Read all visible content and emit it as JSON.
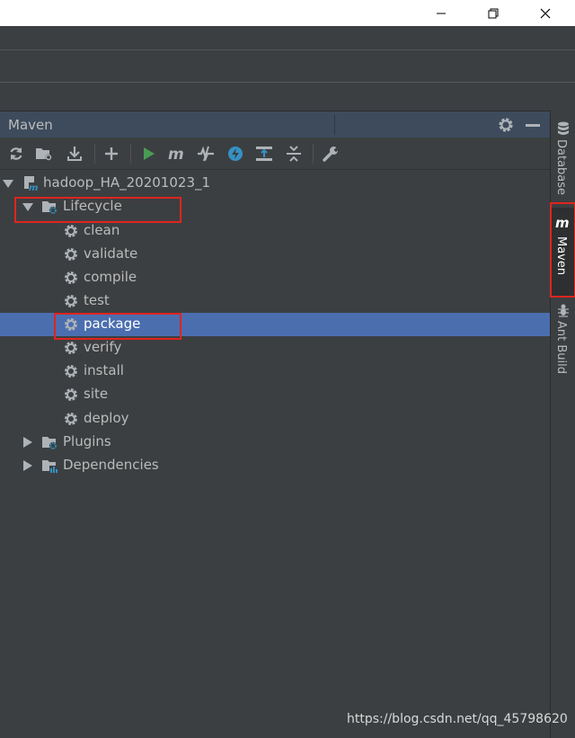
{
  "tool_window": {
    "title": "Maven"
  },
  "toolbar": {
    "buttons": [
      {
        "name": "reload-icon"
      },
      {
        "name": "generate-sources-icon"
      },
      {
        "name": "download-icon"
      },
      {
        "name": "add-icon"
      },
      {
        "name": "run-icon"
      },
      {
        "name": "maven-goal-icon"
      },
      {
        "name": "skip-tests-icon"
      },
      {
        "name": "offline-icon"
      },
      {
        "name": "show-dependencies-icon"
      },
      {
        "name": "collapse-all-icon"
      },
      {
        "name": "settings-wrench-icon"
      }
    ]
  },
  "tree": {
    "project": "hadoop_HA_20201023_1",
    "lifecycle": {
      "label": "Lifecycle",
      "goals": [
        "clean",
        "validate",
        "compile",
        "test",
        "package",
        "verify",
        "install",
        "site",
        "deploy"
      ],
      "selected": "package"
    },
    "plugins": "Plugins",
    "dependencies": "Dependencies"
  },
  "sidebar": {
    "tabs": [
      {
        "label": "Database",
        "icon": "database-icon"
      },
      {
        "label": "Maven",
        "icon": "maven-icon",
        "active": true
      },
      {
        "label": "Ant Build",
        "icon": "ant-icon"
      }
    ]
  },
  "colors": {
    "background": "#3c3f41",
    "header": "#3d4b5c",
    "selection": "#4b6eaf",
    "highlight": "#e0241f",
    "text": "#bbbbbb"
  },
  "watermark": "https://blog.csdn.net/qq_45798620"
}
